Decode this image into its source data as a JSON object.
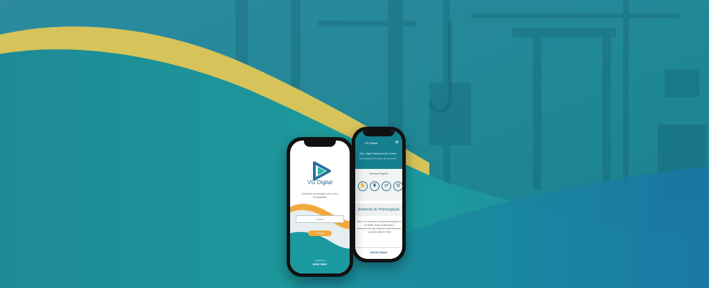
{
  "colors": {
    "sky_teal": "#2c8e9b",
    "teal": "#1b9a9d",
    "lower_blue": "#1a7fa5",
    "gold": "#d6c35a",
    "accent_orange": "#f0a93a"
  },
  "front_phone": {
    "brand": "VG Digital",
    "tagline": "Soluções conectadas com o seu necessidade",
    "input_placeholder": "Usuário",
    "button_label": "ENTRAR",
    "powered_by": "powered by",
    "footer_brand": "WEGE SMAP"
  },
  "back_phone": {
    "app_title": "VG Digital",
    "greeting": "Olá, Ingrid Vasconcelos Costa",
    "subtitle": "Seu passaporte completo do seu Treino",
    "quick_access_label": "Acesso Rápido",
    "quick_icons": [
      "hand-icon",
      "machine-icon",
      "swap-icon",
      "gear-icon"
    ],
    "section_title": "Ambiente de Homologação",
    "notice_text": "Este é um ambiente de testes/homologação do VG Digital. Todas as alterações e procedimentos aqui realizados serão efetivados na versão oficial do SGO.",
    "footer_brand": "WEGE SMAP"
  }
}
